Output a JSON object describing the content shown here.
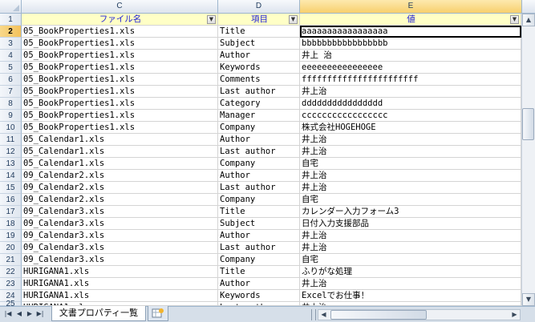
{
  "column_letters": [
    "C",
    "D",
    "E"
  ],
  "headers": {
    "filename": "ファイル名",
    "item": "項目",
    "value": "値"
  },
  "rows": [
    {
      "num": "1"
    },
    {
      "num": "2",
      "file": "05_BookProperties1.xls",
      "item": "Title",
      "value": "aaaaaaaaaaaaaaaaa"
    },
    {
      "num": "3",
      "file": "05_BookProperties1.xls",
      "item": "Subject",
      "value": "bbbbbbbbbbbbbbbbb"
    },
    {
      "num": "4",
      "file": "05_BookProperties1.xls",
      "item": "Author",
      "value": "井上 治"
    },
    {
      "num": "5",
      "file": "05_BookProperties1.xls",
      "item": "Keywords",
      "value": "eeeeeeeeeeeeeeee"
    },
    {
      "num": "6",
      "file": "05_BookProperties1.xls",
      "item": "Comments",
      "value": "fffffffffffffffffffffff"
    },
    {
      "num": "7",
      "file": "05_BookProperties1.xls",
      "item": "Last author",
      "value": "井上治"
    },
    {
      "num": "8",
      "file": "05_BookProperties1.xls",
      "item": "Category",
      "value": "dddddddddddddddd"
    },
    {
      "num": "9",
      "file": "05_BookProperties1.xls",
      "item": "Manager",
      "value": "ccccccccccccccccc"
    },
    {
      "num": "10",
      "file": "05_BookProperties1.xls",
      "item": "Company",
      "value": "株式会社HOGEHOGE"
    },
    {
      "num": "11",
      "file": "05_Calendar1.xls",
      "item": "Author",
      "value": "井上治"
    },
    {
      "num": "12",
      "file": "05_Calendar1.xls",
      "item": "Last author",
      "value": "井上治"
    },
    {
      "num": "13",
      "file": "05_Calendar1.xls",
      "item": "Company",
      "value": "自宅"
    },
    {
      "num": "14",
      "file": "09_Calendar2.xls",
      "item": "Author",
      "value": "井上治"
    },
    {
      "num": "15",
      "file": "09_Calendar2.xls",
      "item": "Last author",
      "value": "井上治"
    },
    {
      "num": "16",
      "file": "09_Calendar2.xls",
      "item": "Company",
      "value": "自宅"
    },
    {
      "num": "17",
      "file": "09_Calendar3.xls",
      "item": "Title",
      "value": "カレンダー入力フォーム3"
    },
    {
      "num": "18",
      "file": "09_Calendar3.xls",
      "item": "Subject",
      "value": "日付入力支援部品"
    },
    {
      "num": "19",
      "file": "09_Calendar3.xls",
      "item": "Author",
      "value": "井上治"
    },
    {
      "num": "20",
      "file": "09_Calendar3.xls",
      "item": "Last author",
      "value": "井上治"
    },
    {
      "num": "21",
      "file": "09_Calendar3.xls",
      "item": "Company",
      "value": "自宅"
    },
    {
      "num": "22",
      "file": "HURIGANA1.xls",
      "item": "Title",
      "value": "ふりがな処理"
    },
    {
      "num": "23",
      "file": "HURIGANA1.xls",
      "item": "Author",
      "value": "井上治"
    },
    {
      "num": "24",
      "file": "HURIGANA1.xls",
      "item": "Keywords",
      "value": "Excelでお仕事！"
    },
    {
      "num": "25",
      "file": "HURIGANA1.xls",
      "item": "Last author",
      "value": "井上治"
    }
  ],
  "sheet_tab": "文書プロパティ一覧",
  "icons": {
    "nav": [
      "first-sheet-icon",
      "prev-sheet-icon",
      "next-sheet-icon",
      "last-sheet-icon"
    ],
    "filter": "filter-dropdown-icon",
    "new_sheet": "insert-sheet-icon"
  },
  "colors": {
    "header_fill": "#ffffc6",
    "header_text": "#2323d6",
    "selected_row": "#f7cf6d"
  }
}
